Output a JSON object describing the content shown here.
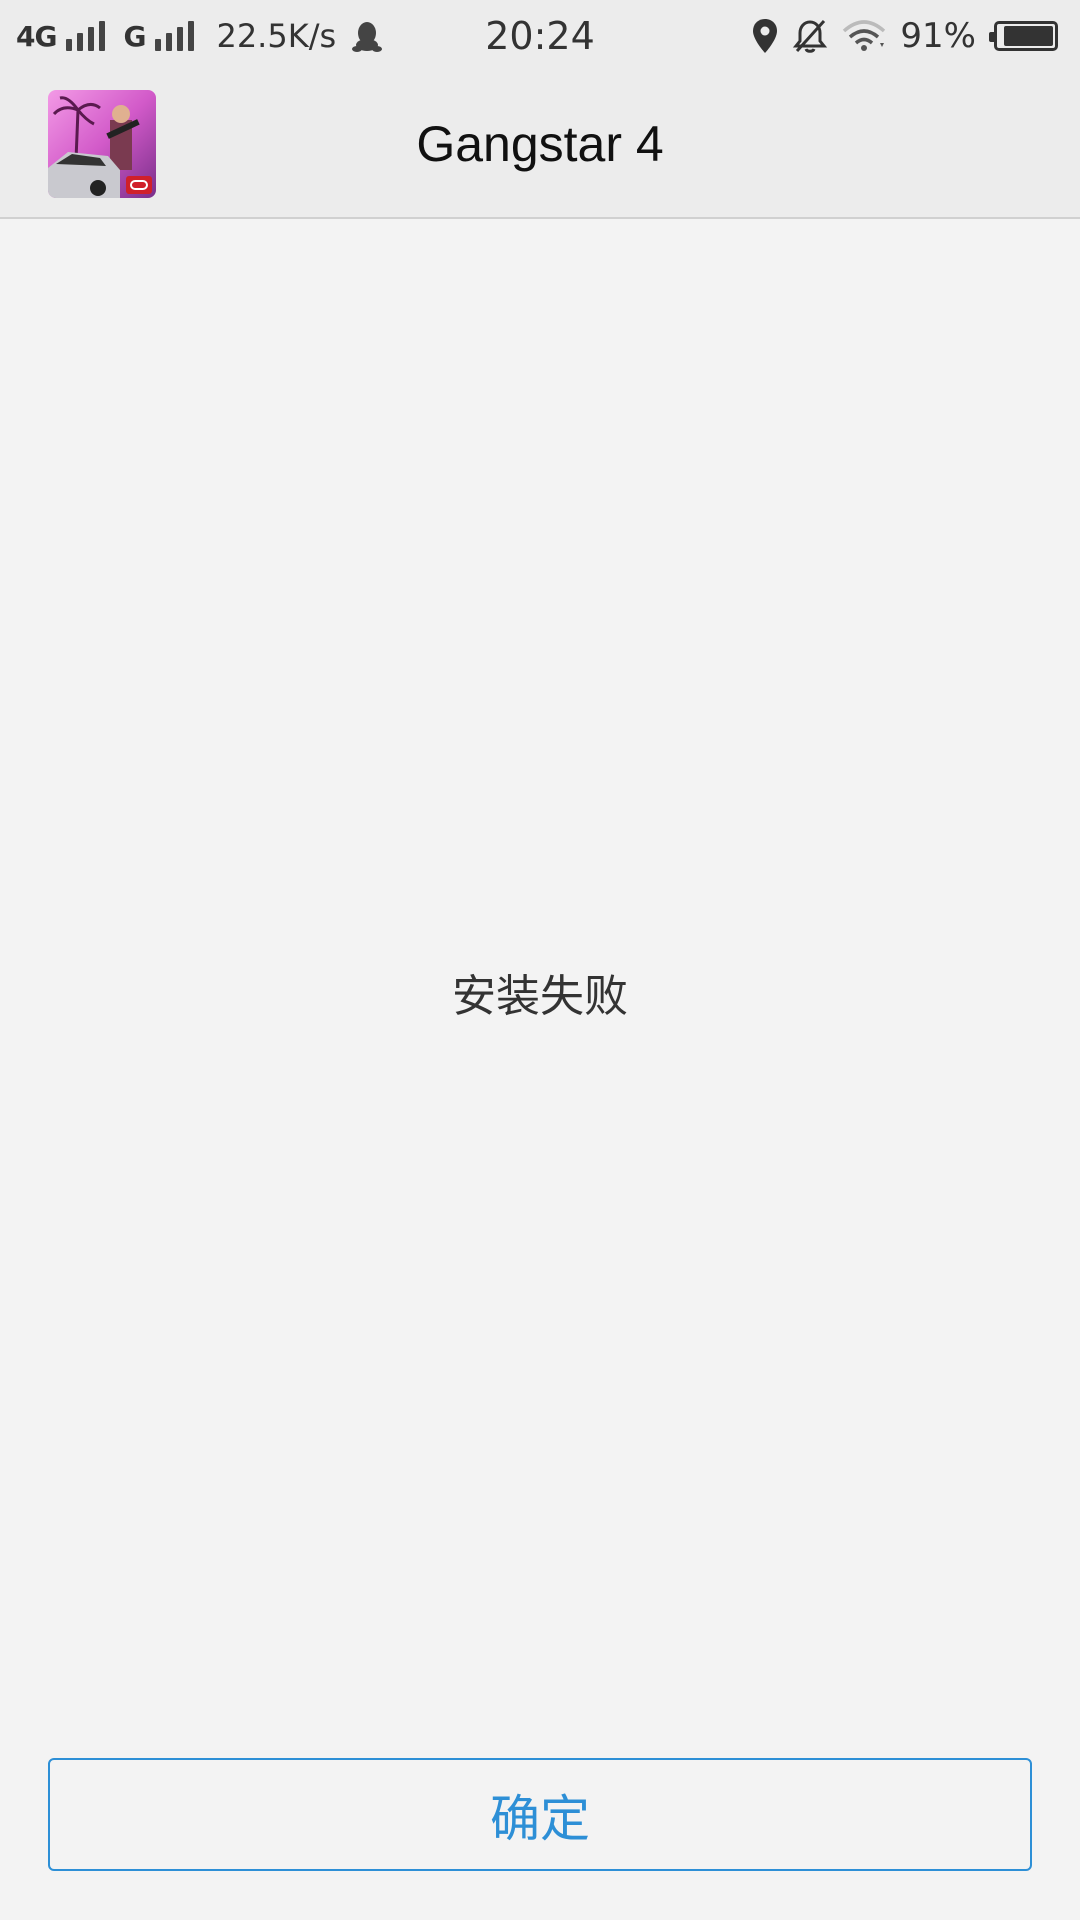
{
  "status_bar": {
    "network_1": "4G",
    "network_2": "G",
    "speed": "22.5K/s",
    "time": "20:24",
    "battery_percent": "91%",
    "battery_level": 0.91,
    "icons": [
      "signal-icon",
      "qq-penguin-icon",
      "location-icon",
      "mute-bell-icon",
      "wifi-icon",
      "battery-icon"
    ]
  },
  "header": {
    "app_name": "Gangstar 4",
    "app_icon": "gangstar-app-icon"
  },
  "main": {
    "message": "安装失败"
  },
  "footer": {
    "confirm_label": "确定"
  },
  "colors": {
    "accent": "#2d8fd6",
    "background": "#f3f3f3",
    "header_background": "#ececec"
  }
}
